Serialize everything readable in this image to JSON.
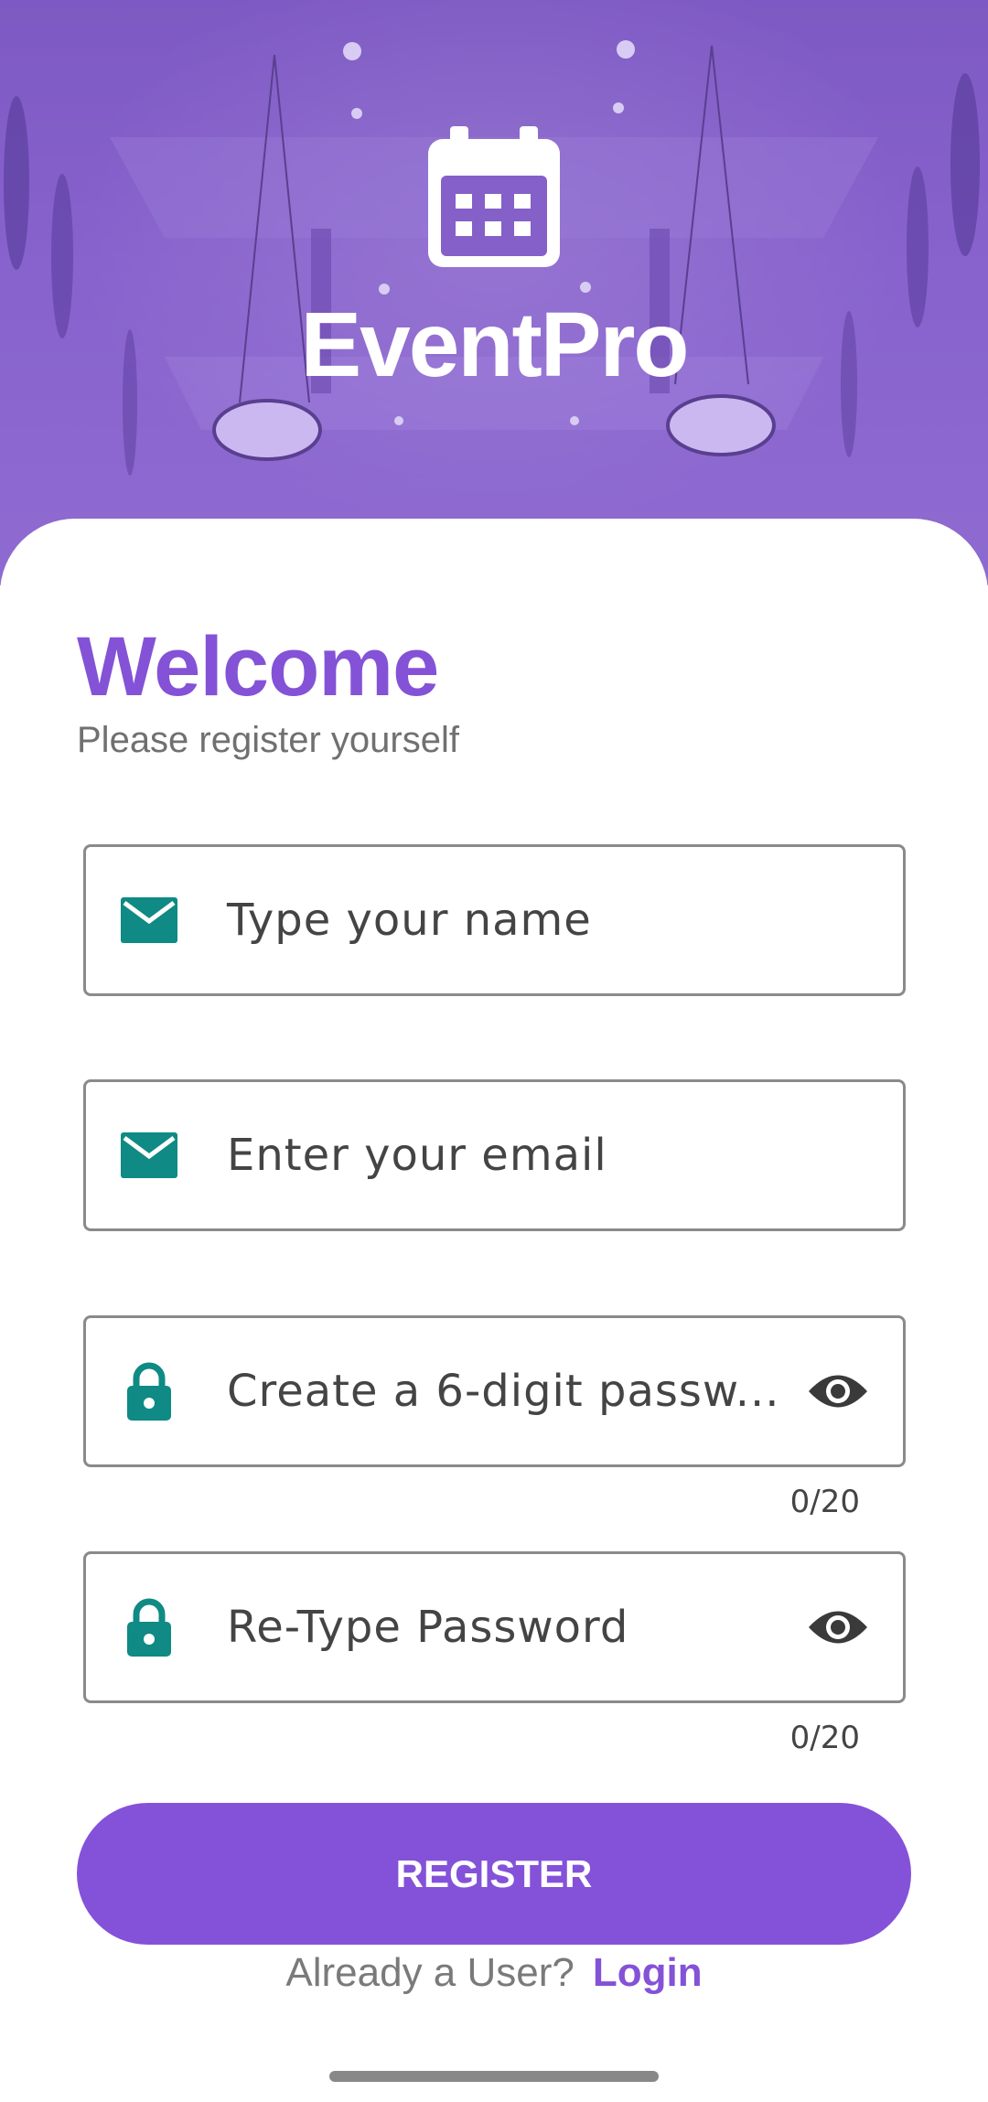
{
  "app": {
    "name": "EventPro",
    "logo_icon": "calendar-icon"
  },
  "colors": {
    "brand": "#8452d6",
    "icon_teal": "#0f8a84",
    "hero_overlay": "#8a63cf"
  },
  "form": {
    "title": "Welcome",
    "subtitle": "Please register yourself",
    "fields": [
      {
        "icon": "mail-icon",
        "placeholder": "Type your name"
      },
      {
        "icon": "mail-icon",
        "placeholder": "Enter your email"
      },
      {
        "icon": "lock-icon",
        "placeholder": "Create a 6-digit passw...",
        "toggle_icon": "eye-icon",
        "counter": "0/20"
      },
      {
        "icon": "lock-icon",
        "placeholder": "Re-Type Password",
        "toggle_icon": "eye-icon",
        "counter": "0/20"
      }
    ],
    "register_label": "REGISTER",
    "footer_text": "Already a User?",
    "login_label": "Login"
  }
}
